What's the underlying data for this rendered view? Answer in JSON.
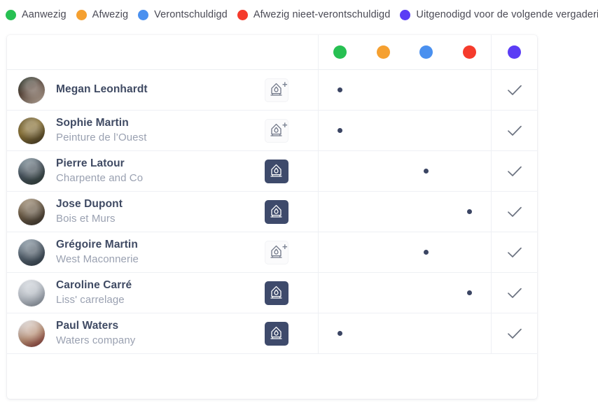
{
  "legend": {
    "items": [
      {
        "label": "Aanwezig",
        "color": "#27c052",
        "key": "present"
      },
      {
        "label": "Afwezig",
        "color": "#f5a030",
        "key": "absent"
      },
      {
        "label": "Verontschuldigd",
        "color": "#4a90ef",
        "key": "excused"
      },
      {
        "label": "Afwezig nieet-verontschuldigd",
        "color": "#f53b2c",
        "key": "absent_unexcused"
      },
      {
        "label": "Uitgenodigd voor de volgende vergadering",
        "color": "#5b3df5",
        "key": "invited_next"
      }
    ]
  },
  "table": {
    "status_columns": [
      {
        "color": "#27c052",
        "name": "status-column-present"
      },
      {
        "color": "#f5a030",
        "name": "status-column-absent"
      },
      {
        "color": "#4a90ef",
        "name": "status-column-excused"
      },
      {
        "color": "#f53b2c",
        "name": "status-column-absent-unexcused"
      },
      {
        "color": "#5b3df5",
        "name": "status-column-invited-next"
      }
    ],
    "check_icon": "check-icon",
    "badge_icon": "pen-nib-icon",
    "rows": [
      {
        "name": "Megan Leonhardt",
        "company": "",
        "badge": "light",
        "status": 0,
        "checked": true,
        "avatar": "av0"
      },
      {
        "name": "Sophie Martin",
        "company": "Peinture de l’Ouest",
        "badge": "light",
        "status": 0,
        "checked": true,
        "avatar": "av1"
      },
      {
        "name": "Pierre Latour",
        "company": "Charpente and Co",
        "badge": "dark",
        "status": 2,
        "checked": true,
        "avatar": "av2"
      },
      {
        "name": "Jose Dupont",
        "company": "Bois et Murs",
        "badge": "dark",
        "status": 3,
        "checked": true,
        "avatar": "av3"
      },
      {
        "name": "Grégoire Martin",
        "company": "West Maconnerie",
        "badge": "light",
        "status": 2,
        "checked": true,
        "avatar": "av4"
      },
      {
        "name": "Caroline  Carré",
        "company": "Liss' carrelage",
        "badge": "dark",
        "status": 3,
        "checked": true,
        "avatar": "av5"
      },
      {
        "name": "Paul Waters",
        "company": "Waters company",
        "badge": "dark",
        "status": 0,
        "checked": true,
        "avatar": "av6"
      }
    ]
  }
}
